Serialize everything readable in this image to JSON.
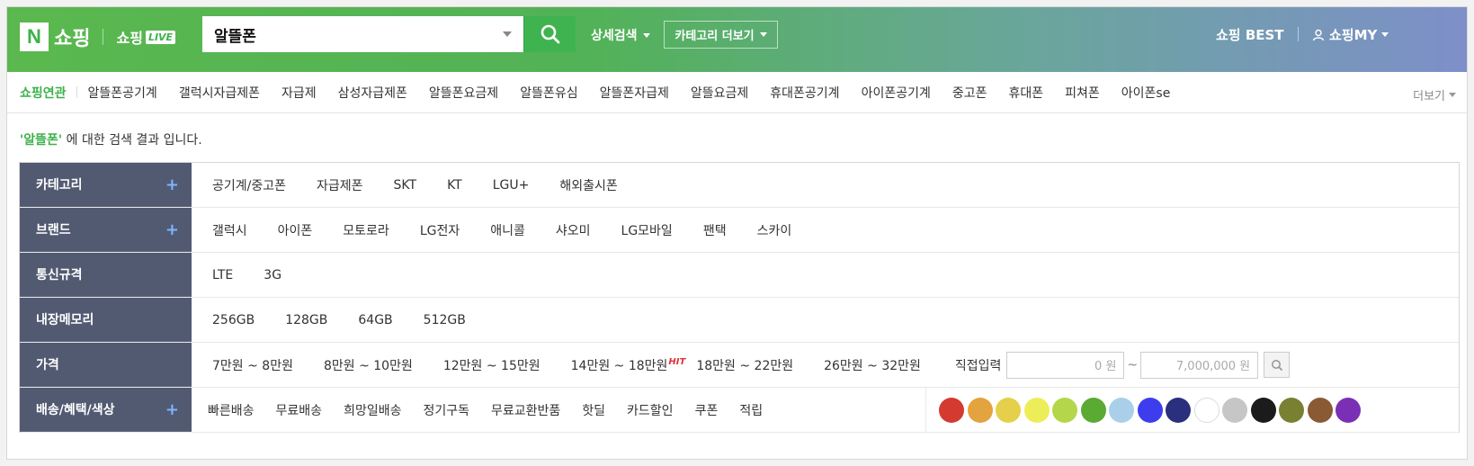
{
  "header": {
    "logo_letter": "N",
    "logo_text": "쇼핑",
    "live_text": "쇼핑",
    "live_badge": "LIVE",
    "search_value": "알뜰폰",
    "detail_search": "상세검색",
    "category_more": "카테고리 더보기",
    "best": "쇼핑 BEST",
    "my": "쇼핑MY"
  },
  "related": {
    "label": "쇼핑연관",
    "items": [
      "알뜰폰공기계",
      "갤럭시자급제폰",
      "자급제",
      "삼성자급제폰",
      "알뜰폰요금제",
      "알뜰폰유심",
      "알뜰폰자급제",
      "알뜰요금제",
      "휴대폰공기계",
      "아이폰공기계",
      "중고폰",
      "휴대폰",
      "피쳐폰",
      "아이폰se"
    ],
    "more": "더보기"
  },
  "result": {
    "query": "'알뜰폰'",
    "suffix": " 에 대한 검색 결과 입니다."
  },
  "filters": {
    "category": {
      "label": "카테고리",
      "plus": "+",
      "options": [
        "공기계/중고폰",
        "자급제폰",
        "SKT",
        "KT",
        "LGU+",
        "해외출시폰"
      ]
    },
    "brand": {
      "label": "브랜드",
      "plus": "+",
      "options": [
        "갤럭시",
        "아이폰",
        "모토로라",
        "LG전자",
        "애니콜",
        "샤오미",
        "LG모바일",
        "팬택",
        "스카이"
      ]
    },
    "network": {
      "label": "통신규격",
      "options": [
        "LTE",
        "3G"
      ]
    },
    "memory": {
      "label": "내장메모리",
      "options": [
        "256GB",
        "128GB",
        "64GB",
        "512GB"
      ]
    },
    "price": {
      "label": "가격",
      "options": [
        "7만원 ~ 8만원",
        "8만원 ~ 10만원",
        "12만원 ~ 15만원",
        "14만원 ~ 18만원",
        "18만원 ~ 22만원",
        "26만원 ~ 32만원"
      ],
      "hit_badge": "HIT",
      "direct_label": "직접입력",
      "min_value": "0 원",
      "tilde": "~",
      "max_value": "7,000,000 원"
    },
    "delivery": {
      "label": "배송/혜택/색상",
      "plus": "+",
      "options": [
        "빠른배송",
        "무료배송",
        "희망일배송",
        "정기구독",
        "무료교환반품",
        "핫딜",
        "카드할인",
        "쿠폰",
        "적립"
      ],
      "colors": [
        "#d43a2f",
        "#e3a33e",
        "#e6cf4a",
        "#eded5a",
        "#b4d64a",
        "#5aaa34",
        "#a9cfe9",
        "#3d3ded",
        "#2a2f7e",
        "#ffffff",
        "#c6c6c6",
        "#1b1b1b",
        "#7a8032",
        "#8a5a34",
        "#7b2fb4"
      ]
    }
  },
  "colors": {
    "brand_green": "#3cb14a",
    "filter_head": "#525a72"
  }
}
